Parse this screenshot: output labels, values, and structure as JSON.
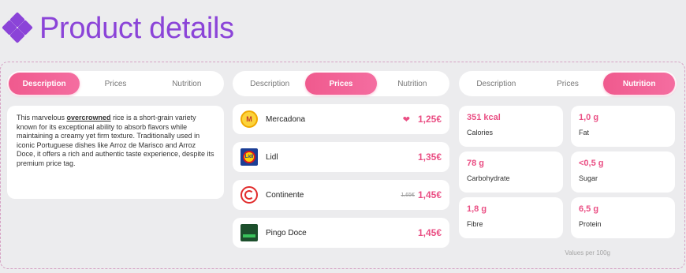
{
  "header": {
    "title": "Product details"
  },
  "panels": [
    {
      "tabs": [
        "Description",
        "Prices",
        "Nutrition"
      ],
      "active": 0,
      "description": {
        "before": "This marvelous ",
        "highlight": "overcrowned",
        "after": " rice is a short-grain variety known for its exceptional ability to absorb flavors while maintaining a creamy yet firm texture. Traditionally used in iconic Portuguese dishes like Arroz de Marisco and Arroz Doce, it offers a rich and authentic taste experience, despite its premium price tag."
      }
    },
    {
      "tabs": [
        "Description",
        "Prices",
        "Nutrition"
      ],
      "active": 1,
      "stores": [
        {
          "name": "Mercadona",
          "logo": "mercadona-logo",
          "badge": "❤",
          "old_price": "",
          "price": "1,25€"
        },
        {
          "name": "Lidl",
          "logo": "lidl-logo",
          "badge": "",
          "old_price": "",
          "price": "1,35€"
        },
        {
          "name": "Continente",
          "logo": "continente-logo",
          "badge": "",
          "old_price": "1,65€",
          "price": "1,45€"
        },
        {
          "name": "Pingo Doce",
          "logo": "pingo-doce-logo",
          "badge": "",
          "old_price": "",
          "price": "1,45€"
        }
      ]
    },
    {
      "tabs": [
        "Description",
        "Prices",
        "Nutrition"
      ],
      "active": 2,
      "nutrition": [
        {
          "value": "351 kcal",
          "label": "Calories"
        },
        {
          "value": "1,0 g",
          "label": "Fat"
        },
        {
          "value": "78 g",
          "label": "Carbohydrate"
        },
        {
          "value": "<0,5 g",
          "label": "Sugar"
        },
        {
          "value": "1,8 g",
          "label": "Fibre"
        },
        {
          "value": "6,5 g",
          "label": "Protein"
        }
      ],
      "note": "Values per 100g"
    }
  ],
  "colors": {
    "accent": "#ea4f84",
    "title": "#8b44d8"
  }
}
